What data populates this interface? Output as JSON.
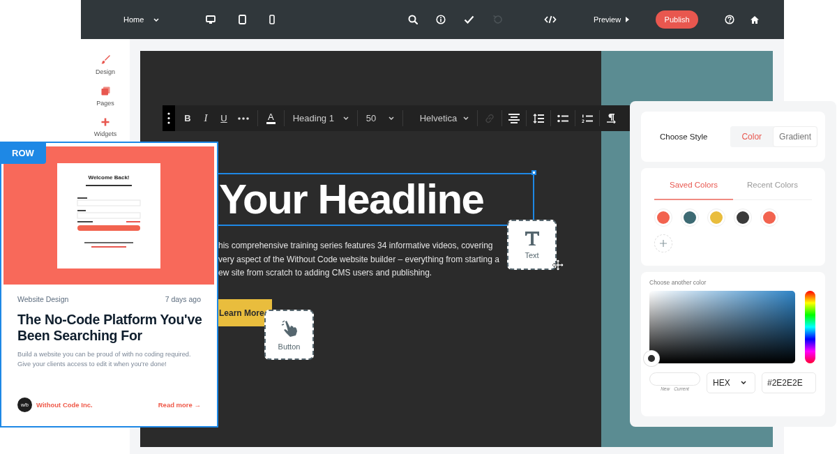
{
  "topbar": {
    "page_menu": {
      "label": "Home"
    },
    "devices": [
      {
        "kind": "desktop"
      },
      {
        "kind": "tablet"
      },
      {
        "kind": "phone"
      }
    ],
    "tools": [
      {
        "kind": "search",
        "disabled": false
      },
      {
        "kind": "info",
        "disabled": false
      },
      {
        "kind": "check",
        "disabled": false
      },
      {
        "kind": "undo",
        "disabled": true
      }
    ],
    "code": {
      "kind": "code"
    },
    "preview": {
      "label": "Preview"
    },
    "publish": {
      "label": "Publish"
    },
    "end_icons": [
      {
        "kind": "help"
      },
      {
        "kind": "home"
      }
    ]
  },
  "sidebar": {
    "items": [
      {
        "label": "Design",
        "kind": "brush"
      },
      {
        "label": "Pages",
        "kind": "pages"
      },
      {
        "label": "Widgets",
        "kind": "plus"
      }
    ]
  },
  "format_toolbar": {
    "styles": [
      {
        "label": "B",
        "kind": "bold"
      },
      {
        "label": "I",
        "kind": "italic"
      },
      {
        "label": "U",
        "kind": "underline"
      },
      {
        "kind": "more"
      }
    ],
    "text_color": {
      "label": "A"
    },
    "dropdowns": [
      {
        "label": "Heading 1",
        "kind": "wide"
      },
      {
        "label": "50",
        "kind": "narrow"
      },
      {
        "label": "Helvetica",
        "kind": "font"
      }
    ],
    "tools": [
      {
        "kind": "link",
        "disabled": true
      },
      {
        "kind": "align",
        "disabled": false
      },
      {
        "kind": "line-height",
        "disabled": false
      },
      {
        "kind": "bullets",
        "disabled": false
      },
      {
        "kind": "numbers",
        "disabled": false
      },
      {
        "kind": "paragraph",
        "disabled": false
      }
    ]
  },
  "canvas": {
    "headline": {
      "text": "Your Headline",
      "selected": true
    },
    "body_lines": [
      "his comprehensive training series features 34 informative videos, covering",
      "very aspect of the Without Code website builder – everything from starting a",
      "ew site from scratch to adding CMS users and publishing."
    ],
    "cta": {
      "label": "Learn More"
    },
    "widget_tiles": [
      {
        "label": "Text",
        "kind": "text"
      },
      {
        "label": "Button",
        "kind": "button"
      }
    ]
  },
  "card": {
    "tag": "ROW",
    "preview": {
      "title": "Welcome Back!"
    },
    "category": "Website Design",
    "age": "7 days ago",
    "title": "The No-Code Platform You've Been Searching For",
    "description": "Build a website you can be proud of with no coding required. Give your clients access to edit it when you're done!",
    "author": {
      "logo": "w/b",
      "name": "Without Code Inc."
    },
    "link": "Read more →"
  },
  "color_panel": {
    "style_label": "Choose Style",
    "style_options": [
      {
        "label": "Color",
        "selected": true
      },
      {
        "label": "Gradient",
        "selected": false
      }
    ],
    "tabs": [
      {
        "label": "Saved Colors",
        "selected": true
      },
      {
        "label": "Recent Colors",
        "selected": false
      }
    ],
    "saved_colors": [
      {
        "color": "#f2634f"
      },
      {
        "color": "#3d6a73"
      },
      {
        "color": "#e9bd3d"
      },
      {
        "color": "#3a3a3a"
      },
      {
        "color": "#f2634f"
      }
    ],
    "picker": {
      "label": "Choose another color",
      "preview_labels": [
        "New",
        "Current"
      ],
      "format": "HEX",
      "value": "#2E2E2E"
    }
  }
}
